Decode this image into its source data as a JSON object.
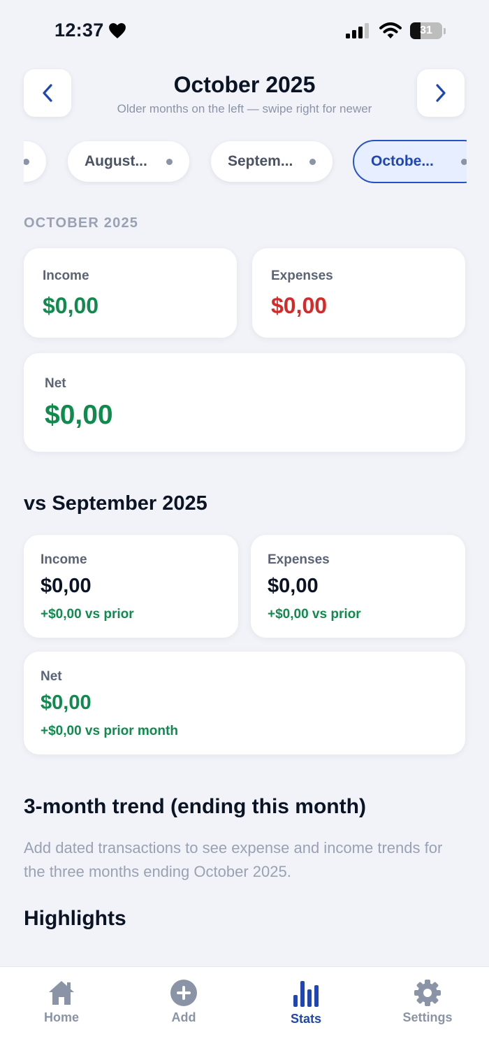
{
  "status_bar": {
    "time": "12:37",
    "battery": "31"
  },
  "header": {
    "title": "October 2025",
    "subtitle": "Older months on the left — swipe right for newer"
  },
  "month_chips": [
    {
      "label": "August..."
    },
    {
      "label": "Septem..."
    },
    {
      "label": "Octobe...",
      "active": true
    }
  ],
  "summary": {
    "caption": "OCTOBER 2025",
    "income_label": "Income",
    "income_value": "$0,00",
    "expenses_label": "Expenses",
    "expenses_value": "$0,00",
    "net_label": "Net",
    "net_value": "$0,00"
  },
  "comparison": {
    "title": "vs September 2025",
    "income_label": "Income",
    "income_value": "$0,00",
    "income_delta": "+$0,00 vs prior",
    "expenses_label": "Expenses",
    "expenses_value": "$0,00",
    "expenses_delta": "+$0,00 vs prior",
    "net_label": "Net",
    "net_value": "$0,00",
    "net_delta": "+$0,00 vs prior month"
  },
  "trend": {
    "title": "3-month trend (ending this month)",
    "description": "Add dated transactions to see expense and income trends for the three months ending October 2025."
  },
  "highlights": {
    "title": "Highlights"
  },
  "tabs": [
    {
      "label": "Home",
      "icon": "home-icon"
    },
    {
      "label": "Add",
      "icon": "plus-circle-icon"
    },
    {
      "label": "Stats",
      "icon": "bar-chart-icon",
      "active": true
    },
    {
      "label": "Settings",
      "icon": "gear-icon"
    }
  ],
  "colors": {
    "accent": "#1E46B5",
    "positive": "#108A4D",
    "negative": "#D42A2A",
    "background": "#F1F3F8"
  }
}
